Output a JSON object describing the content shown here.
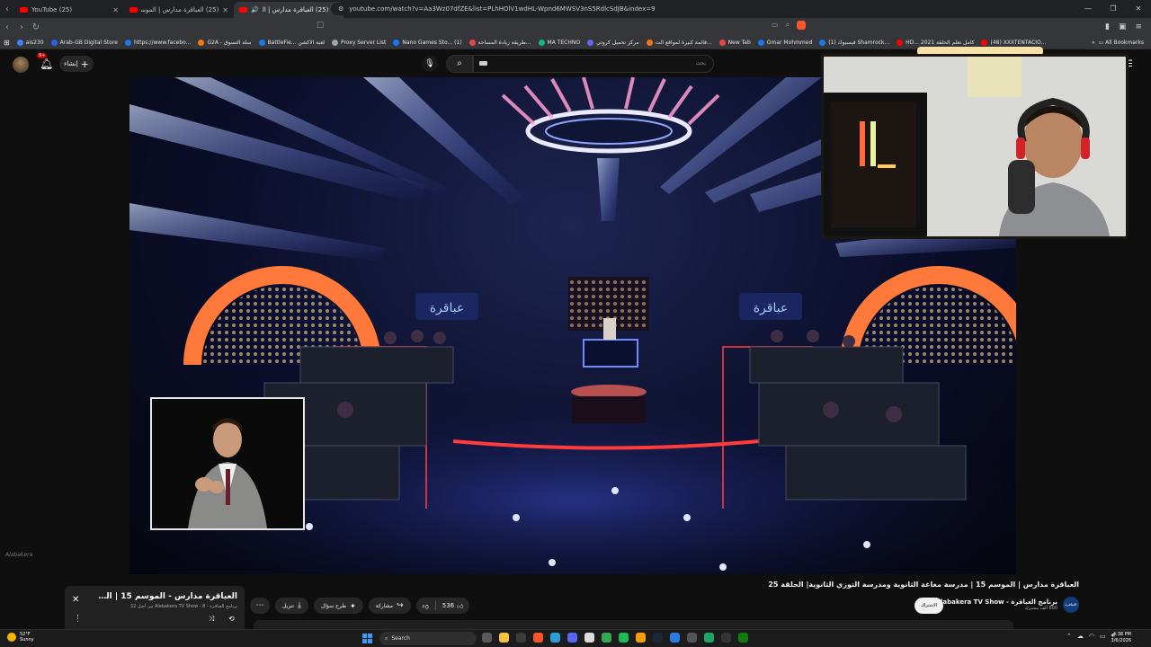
{
  "browser": {
    "tabs": [
      {
        "title": "(25) YouTube",
        "active": false
      },
      {
        "title": "(25) العباقرة مدارس | الموسم 15 | مدا...",
        "active": false
      },
      {
        "title": "(25) العباقرة مدارس | الموسم...",
        "active": true
      }
    ],
    "new_tab": "+",
    "url": "youtube.com/watch?v=Aa3Wz07dfZE&list=PLhHOlV1wdHL-Wpnd6MWSV3nS5RdlcSdJB&index=9",
    "bookmarks": [
      "ais230",
      "Arab-GB Digital Store",
      "https://www.facebo...",
      "G2A - سلة التسوق",
      "BattleFie... لعبة الاكشن",
      "Proxy Server List",
      "Nano Games Sto... (1)",
      "طريقة زيادة المساحة...",
      "MA TECHNO",
      "مركز تحميل كروتي",
      "قائمة كبيرة لمواقع الت...",
      "New Tab",
      "Omar Mohmmed",
      "(1) فيسبوك Shamrock...",
      "HD... كامل تعلم الحلقة 2021",
      "(48) XXXTENTACIO..."
    ],
    "all_bookmarks": "All Bookmarks"
  },
  "youtube": {
    "notification_count": "9+",
    "create_label": "إنشاء",
    "search_placeholder": "بحث"
  },
  "video": {
    "title": "العباقرة مدارس | الموسم 15 | مدرسة مغاغة الثانوية ومدرسة التوزي الثانوية| الحلقة 25",
    "channel_name": "برنامج العباقرة - Alabakera TV Show",
    "channel_subs": "600 ألف مشترك",
    "channel_logo_text": "العباقرة",
    "subscribe_label": "الاشتراك",
    "like_count": "536",
    "share_label": "مشاركة",
    "ask_label": "طرح سؤال",
    "download_label": "تنزيل",
    "more_label": "..."
  },
  "mini_player": {
    "title": "العباقرة مدارس - الموسم 15 | الحلقة...",
    "subtitle": "برنامج العباقرة - Alabakera TV Show - 8 من أصل 32"
  },
  "taskbar": {
    "temperature": "52°F",
    "weather": "Sunny",
    "search_label": "Search",
    "time": "4:38 PM",
    "date": "3/6/2026"
  },
  "colors": {
    "yt_red": "#ff0000",
    "stage_blue": "#6f8cff",
    "neon_red": "#ff3b3b",
    "ring_orange": "#ff7a3a"
  }
}
